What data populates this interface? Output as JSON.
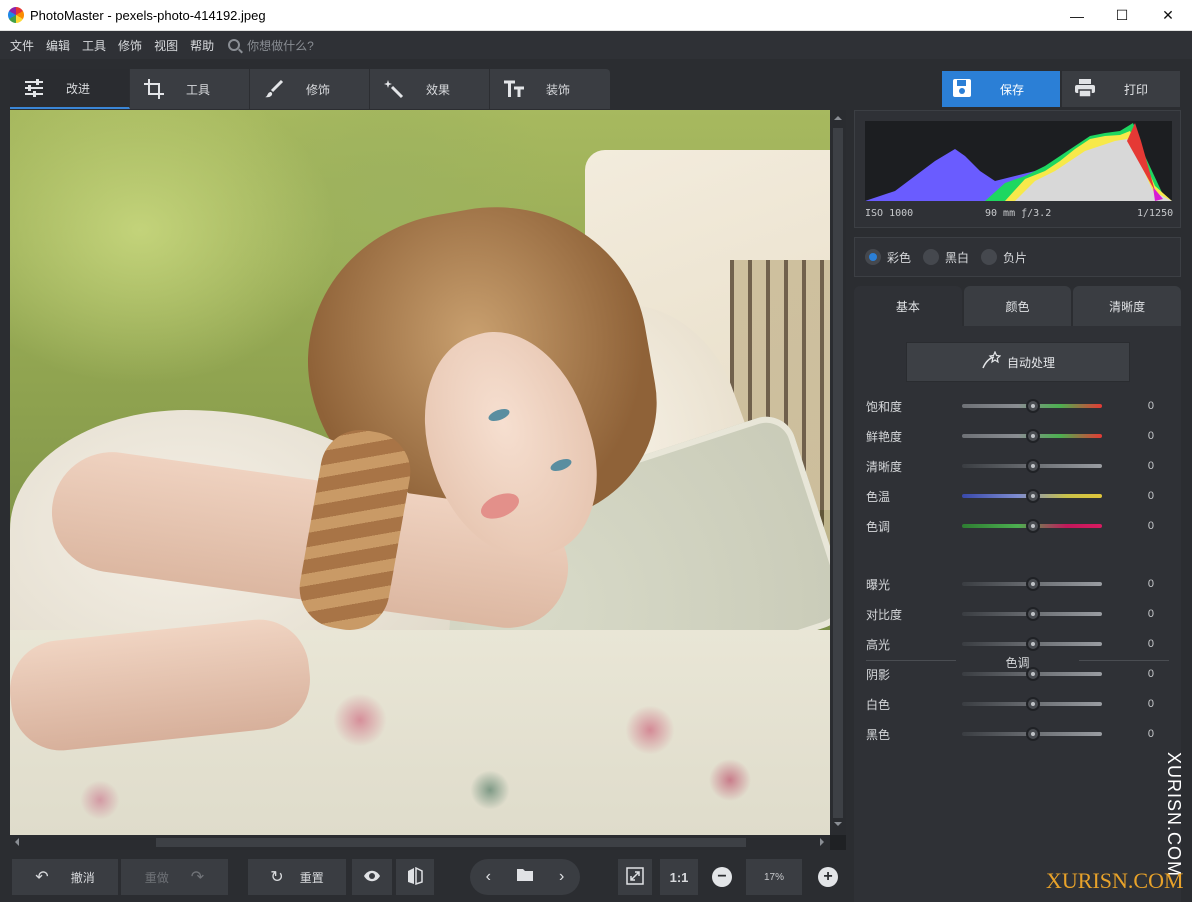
{
  "window": {
    "title": "PhotoMaster - pexels-photo-414192.jpeg",
    "minimize": "—",
    "maximize": "☐",
    "close": "✕"
  },
  "menu": {
    "items": [
      "文件",
      "编辑",
      "工具",
      "修饰",
      "视图",
      "帮助"
    ],
    "search_placeholder": "你想做什么?"
  },
  "tabs": [
    {
      "label": "改进",
      "icon": "sliders-icon"
    },
    {
      "label": "工具",
      "icon": "crop-icon"
    },
    {
      "label": "修饰",
      "icon": "brush-icon"
    },
    {
      "label": "效果",
      "icon": "magic-wand-icon"
    },
    {
      "label": "装饰",
      "icon": "text-icon"
    }
  ],
  "actions": {
    "save": "保存",
    "print": "打印"
  },
  "histogram": {
    "iso": "ISO 1000",
    "lens": "90 mm ƒ/3.2",
    "shutter": "1/1250"
  },
  "color_mode": {
    "options": [
      "彩色",
      "黑白",
      "负片"
    ],
    "selected": "彩色"
  },
  "sub_tabs": [
    "基本",
    "颜色",
    "清晰度"
  ],
  "auto_button": "自动处理",
  "sliders_basic": [
    {
      "label": "饱和度",
      "value": "0",
      "gradient": "linear-gradient(90deg,#6e7176,#8a8d92 40%,#4caf50 70%,#e53935)"
    },
    {
      "label": "鲜艳度",
      "value": "0",
      "gradient": "linear-gradient(90deg,#6e7176,#8a8d92 40%,#4caf50 70%,#e53935)"
    },
    {
      "label": "清晰度",
      "value": "0",
      "gradient": "linear-gradient(90deg,#3a3d42,#9a9da2)"
    },
    {
      "label": "色温",
      "value": "0",
      "gradient": "linear-gradient(90deg,#3949ab,#7e8cd0 40%,#c9c24a 75%,#e0c53a)"
    },
    {
      "label": "色调",
      "value": "0",
      "gradient": "linear-gradient(90deg,#2e7d32,#4caf50 40%,#c2185b 75%,#d81b60)"
    }
  ],
  "section_tone": "色调",
  "sliders_tone": [
    {
      "label": "曝光",
      "value": "0"
    },
    {
      "label": "对比度",
      "value": "0"
    },
    {
      "label": "高光",
      "value": "0"
    },
    {
      "label": "阴影",
      "value": "0"
    },
    {
      "label": "白色",
      "value": "0"
    },
    {
      "label": "黑色",
      "value": "0"
    }
  ],
  "bottom": {
    "undo": "撤消",
    "redo": "重做",
    "reset": "重置",
    "ratio": "1:1",
    "zoom": "17%"
  },
  "watermark": {
    "vertical": "XURISN.COM",
    "horizontal": "XURISN.COM"
  },
  "colors": {
    "accent": "#2b7fd6",
    "panel": "#2f3136",
    "background": "#2b2d31"
  }
}
